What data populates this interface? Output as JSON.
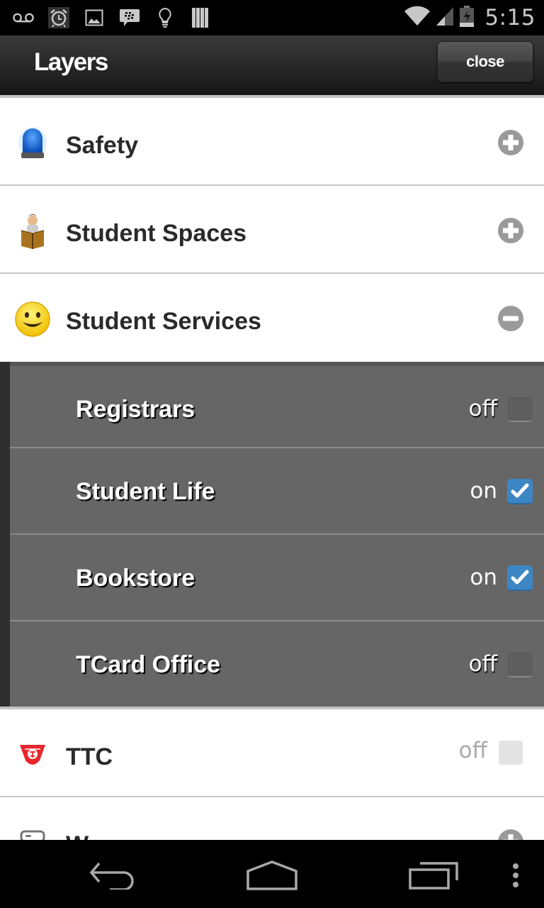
{
  "status_bar": {
    "left_icons": [
      "voicemail-icon",
      "alarm-icon",
      "gallery-icon",
      "bbm-icon",
      "lightbulb-icon",
      "barcode-icon"
    ],
    "right_icons": [
      "wifi-icon",
      "signal-icon",
      "battery-charging-icon"
    ],
    "time": "5:15"
  },
  "action_bar": {
    "title": "Layers",
    "close_label": "close"
  },
  "layers": [
    {
      "label": "Safety",
      "icon": "siren-icon",
      "control": "expand",
      "expanded": false
    },
    {
      "label": "Student Spaces",
      "icon": "student-reading-icon",
      "control": "expand",
      "expanded": false
    },
    {
      "label": "Student Services",
      "icon": "smiley-icon",
      "control": "collapse",
      "expanded": true,
      "children": [
        {
          "label": "Registrars",
          "state": "off",
          "checked": false
        },
        {
          "label": "Student Life",
          "state": "on",
          "checked": true
        },
        {
          "label": "Bookstore",
          "state": "on",
          "checked": true
        },
        {
          "label": "TCard Office",
          "state": "off",
          "checked": false
        }
      ]
    },
    {
      "label": "TTC",
      "icon": "ttc-logo-icon",
      "control": "checkbox",
      "state": "off",
      "checked": false
    },
    {
      "label": "W...",
      "icon": "washroom-icon",
      "control": "expand",
      "expanded": false,
      "partially_visible": true
    }
  ],
  "colors": {
    "checkbox_checked": "#3d86c4",
    "submenu_bg": "#666666",
    "action_bar_top": "#3a3a3a",
    "toggle_grey": "#9a9a9a"
  },
  "nav_bar": {
    "buttons": [
      "back-icon",
      "home-icon",
      "recent-apps-icon",
      "overflow-menu-icon"
    ]
  }
}
